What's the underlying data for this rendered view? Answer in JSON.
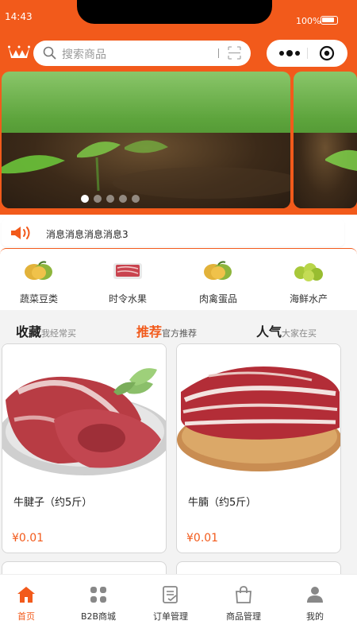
{
  "status_bar": {
    "time": "14:43",
    "battery": "100%"
  },
  "header": {
    "search_placeholder": "搜索商品"
  },
  "banner": {
    "slide_count": 5,
    "active_index": 0
  },
  "notice": {
    "text": "消息消息消息消息3"
  },
  "categories": [
    {
      "label": "蔬菜豆类",
      "icon": "mango-icon"
    },
    {
      "label": "时令水果",
      "icon": "meat-tray-icon"
    },
    {
      "label": "肉禽蛋品",
      "icon": "mango-icon"
    },
    {
      "label": "海鲜水产",
      "icon": "lime-fruit-icon"
    }
  ],
  "sections": [
    {
      "title": "收藏",
      "subtitle": "我经常买"
    },
    {
      "title": "推荐",
      "subtitle": "官方推荐"
    },
    {
      "title": "人气",
      "subtitle": "大家在买"
    }
  ],
  "products": [
    {
      "name": "牛腱子（约5斤）",
      "price": "¥0.01"
    },
    {
      "name": "牛腩（约5斤）",
      "price": "¥0.01"
    }
  ],
  "tabbar": [
    {
      "label": "首页",
      "icon": "home-icon"
    },
    {
      "label": "B2B商城",
      "icon": "grid-icon"
    },
    {
      "label": "订单管理",
      "icon": "order-icon"
    },
    {
      "label": "商品管理",
      "icon": "bag-icon"
    },
    {
      "label": "我的",
      "icon": "user-icon"
    }
  ],
  "colors": {
    "brand": "#f25a1b",
    "price": "#f25a1b",
    "background": "#f3f3f3"
  }
}
